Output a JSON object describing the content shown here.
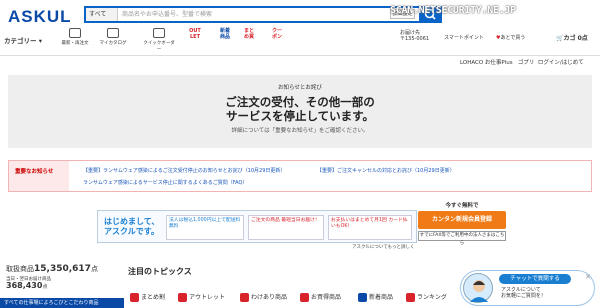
{
  "header": {
    "logo": "ASKUL",
    "search": {
      "category": "すべて",
      "placeholder": "商品名やお申込番号、型番で検索",
      "advanced": "詳細設定"
    },
    "watermark": "SCAN.NETSECURITY.NE.JP",
    "category_button": "カテゴリー",
    "nav": [
      {
        "label": "最新・再注文"
      },
      {
        "label": "マイカタログ"
      },
      {
        "label": "クイックオーダー"
      }
    ],
    "promos": [
      {
        "label": "OUT LET",
        "color": "#d9232b"
      },
      {
        "label": "新着商品",
        "color": "#0a4aa6"
      },
      {
        "label": "まとめ買",
        "color": "#d9232b"
      },
      {
        "label": "クーポン",
        "color": "#d9232b"
      }
    ],
    "address_label": "お届け先",
    "address_zip": "〒135-0061",
    "points": "スマートポイント",
    "favorites": "あとで買う",
    "cart": "カゴ 0点"
  },
  "sub_header": {
    "links": [
      "LOHACO お仕事Plus",
      "ゴプリ",
      "ログイン/はじめて"
    ]
  },
  "outage": {
    "label": "お知らせとお詫び",
    "title_line1": "ご注文の受付、その他一部の",
    "title_line2": "サービスを停止しています。",
    "detail": "詳細については「重要なお知らせ」をご確認ください。"
  },
  "important": {
    "label": "重要なお知らせ",
    "links": [
      "【重要】ランサムウェア感染によるご注文受付停止のお知らせとお詫び（10月29日更新）",
      "【重要】ご注文キャンセルの対応とお詫び（10月29日更新）",
      "ランサムウェア感染によるサービス停止に関するよくあるご質問（FAQ）"
    ]
  },
  "banner": {
    "logo_line1": "はじめまして、",
    "logo_line2": "アスクルです。",
    "boxes": [
      "法人は税込1,000円以上で配送料無料",
      "ご注文の商品 最短当日お届け！",
      "お支払いはまとめて月1回 カード払いもOK！"
    ],
    "free_text": "今すぐ無料で",
    "cta": "カンタン新規会員登録",
    "cta2": "すでにFAX等でご利用中の法人さまはこちら",
    "note": "アスクルについてもっと詳しく"
  },
  "counts": {
    "label1": "取扱商品",
    "value1": "15,350,617",
    "unit1": "点",
    "label2a": "当日・翌日お届け商品",
    "value2": "368,430",
    "unit2": "点"
  },
  "topics_title": "注目のトピックス",
  "categories": [
    {
      "label": "まとめ割",
      "color": "#d9232b"
    },
    {
      "label": "アウトレット",
      "color": "#d9232b"
    },
    {
      "label": "わけあり商品",
      "color": "#d9232b"
    },
    {
      "label": "お買得商品",
      "color": "#d9232b"
    },
    {
      "label": "新着商品",
      "color": "#0a4aa6"
    },
    {
      "label": "ランキング",
      "color": "#d9232b"
    }
  ],
  "bottom_tab": "すべての仕事場によろこびとこだわり商品",
  "chat": {
    "title": "チャットで質問する",
    "body_line1": "アスクルについて",
    "body_line2": "お気軽にご質問を！"
  }
}
